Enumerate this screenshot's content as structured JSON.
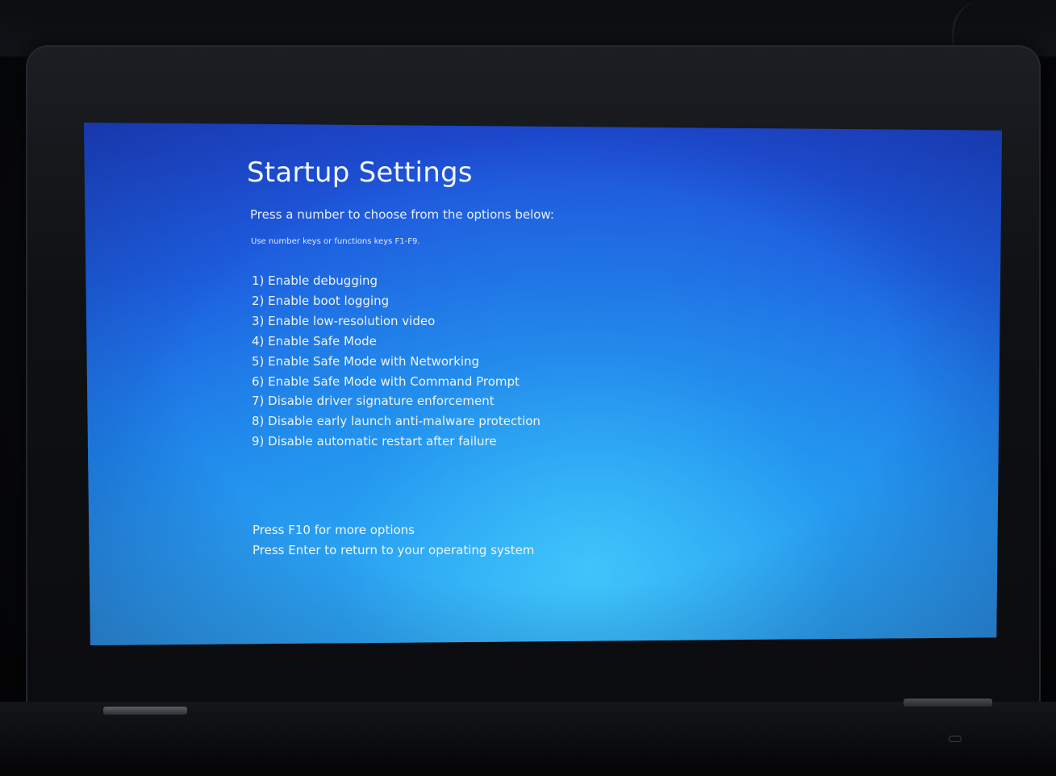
{
  "startup_settings": {
    "title": "Startup Settings",
    "subtitle": "Press a number to choose from the options below:",
    "hint": "Use number keys or functions keys F1-F9.",
    "options": [
      "1) Enable debugging",
      "2) Enable boot logging",
      "3) Enable low-resolution video",
      "4) Enable Safe Mode",
      "5) Enable Safe Mode with Networking",
      "6) Enable Safe Mode with Command Prompt",
      "7) Disable driver signature enforcement",
      "8) Disable early launch anti-malware protection",
      "9) Disable automatic restart after failure"
    ],
    "footer": {
      "more_options": "Press F10 for more options",
      "return": "Press Enter to return to your operating system"
    }
  },
  "colors": {
    "screen_top": "#1f4bd6",
    "screen_bottom": "#33a9f1",
    "text": "#eef4ff",
    "bezel": "#0e1013"
  }
}
